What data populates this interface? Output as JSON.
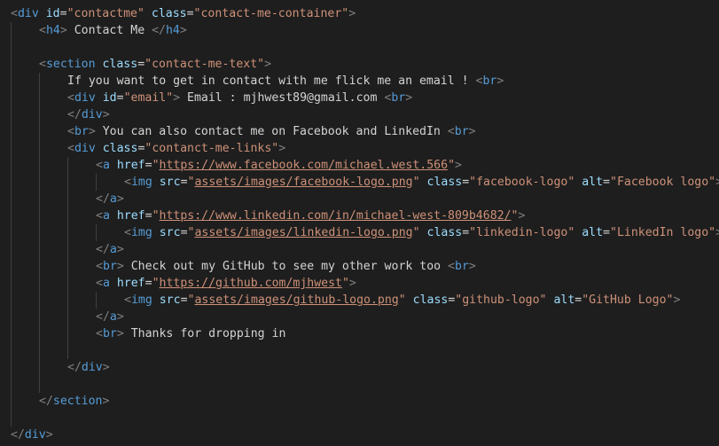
{
  "colors": {
    "background": "#1e1e1e",
    "bracket": "#808080",
    "tag": "#569cd6",
    "attribute": "#9cdcfe",
    "string": "#ce9178",
    "text": "#d4d4d4",
    "indent_guide": "#404040"
  },
  "lines": [
    {
      "indent": 0,
      "tokens": [
        [
          "br",
          "<"
        ],
        [
          "tag",
          "div"
        ],
        [
          "txt",
          " "
        ],
        [
          "attr",
          "id"
        ],
        [
          "eq",
          "="
        ],
        [
          "str",
          "\"contactme\""
        ],
        [
          "txt",
          " "
        ],
        [
          "attr",
          "class"
        ],
        [
          "eq",
          "="
        ],
        [
          "str",
          "\"contact-me-container\""
        ],
        [
          "br",
          ">"
        ]
      ]
    },
    {
      "indent": 1,
      "tokens": [
        [
          "br",
          "<"
        ],
        [
          "tag",
          "h4"
        ],
        [
          "br",
          ">"
        ],
        [
          "txt",
          " Contact Me "
        ],
        [
          "br",
          "</"
        ],
        [
          "tag",
          "h4"
        ],
        [
          "br",
          ">"
        ]
      ]
    },
    {
      "indent": 0,
      "tokens": []
    },
    {
      "indent": 1,
      "tokens": [
        [
          "br",
          "<"
        ],
        [
          "tag",
          "section"
        ],
        [
          "txt",
          " "
        ],
        [
          "attr",
          "class"
        ],
        [
          "eq",
          "="
        ],
        [
          "str",
          "\"contact-me-text\""
        ],
        [
          "br",
          ">"
        ]
      ]
    },
    {
      "indent": 2,
      "tokens": [
        [
          "txt",
          "If you want to get in contact with me flick me an email ! "
        ],
        [
          "br",
          "<"
        ],
        [
          "tag",
          "br"
        ],
        [
          "br",
          ">"
        ]
      ]
    },
    {
      "indent": 2,
      "tokens": [
        [
          "br",
          "<"
        ],
        [
          "tag",
          "div"
        ],
        [
          "txt",
          " "
        ],
        [
          "attr",
          "id"
        ],
        [
          "eq",
          "="
        ],
        [
          "str",
          "\"email\""
        ],
        [
          "br",
          ">"
        ],
        [
          "txt",
          " Email : mjhwest89@gmail.com "
        ],
        [
          "br",
          "<"
        ],
        [
          "tag",
          "br"
        ],
        [
          "br",
          ">"
        ]
      ]
    },
    {
      "indent": 2,
      "tokens": [
        [
          "br",
          "</"
        ],
        [
          "tag",
          "div"
        ],
        [
          "br",
          ">"
        ]
      ]
    },
    {
      "indent": 2,
      "tokens": [
        [
          "br",
          "<"
        ],
        [
          "tag",
          "br"
        ],
        [
          "br",
          ">"
        ],
        [
          "txt",
          " You can also contact me on Facebook and LinkedIn "
        ],
        [
          "br",
          "<"
        ],
        [
          "tag",
          "br"
        ],
        [
          "br",
          ">"
        ]
      ]
    },
    {
      "indent": 2,
      "tokens": [
        [
          "br",
          "<"
        ],
        [
          "tag",
          "div"
        ],
        [
          "txt",
          " "
        ],
        [
          "attr",
          "class"
        ],
        [
          "eq",
          "="
        ],
        [
          "str",
          "\"contanct-me-links\""
        ],
        [
          "br",
          ">"
        ]
      ]
    },
    {
      "indent": 3,
      "tokens": [
        [
          "br",
          "<"
        ],
        [
          "tag",
          "a"
        ],
        [
          "txt",
          " "
        ],
        [
          "attr",
          "href"
        ],
        [
          "eq",
          "="
        ],
        [
          "str",
          "\""
        ],
        [
          "url",
          "https://www.facebook.com/michael.west.566"
        ],
        [
          "str",
          "\""
        ],
        [
          "br",
          ">"
        ]
      ]
    },
    {
      "indent": 4,
      "tokens": [
        [
          "br",
          "<"
        ],
        [
          "tag",
          "img"
        ],
        [
          "txt",
          " "
        ],
        [
          "attr",
          "src"
        ],
        [
          "eq",
          "="
        ],
        [
          "str",
          "\""
        ],
        [
          "url",
          "assets/images/facebook-logo.png"
        ],
        [
          "str",
          "\""
        ],
        [
          "txt",
          " "
        ],
        [
          "attr",
          "class"
        ],
        [
          "eq",
          "="
        ],
        [
          "str",
          "\"facebook-logo\""
        ],
        [
          "txt",
          " "
        ],
        [
          "attr",
          "alt"
        ],
        [
          "eq",
          "="
        ],
        [
          "str",
          "\"Facebook logo\""
        ],
        [
          "br",
          ">"
        ]
      ]
    },
    {
      "indent": 3,
      "tokens": [
        [
          "br",
          "</"
        ],
        [
          "tag",
          "a"
        ],
        [
          "br",
          ">"
        ]
      ]
    },
    {
      "indent": 3,
      "tokens": [
        [
          "br",
          "<"
        ],
        [
          "tag",
          "a"
        ],
        [
          "txt",
          " "
        ],
        [
          "attr",
          "href"
        ],
        [
          "eq",
          "="
        ],
        [
          "str",
          "\""
        ],
        [
          "url",
          "https://www.linkedin.com/in/michael-west-809b4682/"
        ],
        [
          "str",
          "\""
        ],
        [
          "br",
          ">"
        ]
      ]
    },
    {
      "indent": 4,
      "tokens": [
        [
          "br",
          "<"
        ],
        [
          "tag",
          "img"
        ],
        [
          "txt",
          " "
        ],
        [
          "attr",
          "src"
        ],
        [
          "eq",
          "="
        ],
        [
          "str",
          "\""
        ],
        [
          "url",
          "assets/images/linkedin-logo.png"
        ],
        [
          "str",
          "\""
        ],
        [
          "txt",
          " "
        ],
        [
          "attr",
          "class"
        ],
        [
          "eq",
          "="
        ],
        [
          "str",
          "\"linkedin-logo\""
        ],
        [
          "txt",
          " "
        ],
        [
          "attr",
          "alt"
        ],
        [
          "eq",
          "="
        ],
        [
          "str",
          "\"LinkedIn logo\""
        ],
        [
          "br",
          ">"
        ]
      ]
    },
    {
      "indent": 3,
      "tokens": [
        [
          "br",
          "</"
        ],
        [
          "tag",
          "a"
        ],
        [
          "br",
          ">"
        ]
      ]
    },
    {
      "indent": 3,
      "tokens": [
        [
          "br",
          "<"
        ],
        [
          "tag",
          "br"
        ],
        [
          "br",
          ">"
        ],
        [
          "txt",
          " Check out my GitHub to see my other work too "
        ],
        [
          "br",
          "<"
        ],
        [
          "tag",
          "br"
        ],
        [
          "br",
          ">"
        ]
      ]
    },
    {
      "indent": 3,
      "tokens": [
        [
          "br",
          "<"
        ],
        [
          "tag",
          "a"
        ],
        [
          "txt",
          " "
        ],
        [
          "attr",
          "href"
        ],
        [
          "eq",
          "="
        ],
        [
          "str",
          "\""
        ],
        [
          "url",
          "https://github.com/mjhwest"
        ],
        [
          "str",
          "\""
        ],
        [
          "br",
          ">"
        ]
      ]
    },
    {
      "indent": 4,
      "tokens": [
        [
          "br",
          "<"
        ],
        [
          "tag",
          "img"
        ],
        [
          "txt",
          " "
        ],
        [
          "attr",
          "src"
        ],
        [
          "eq",
          "="
        ],
        [
          "str",
          "\""
        ],
        [
          "url",
          "assets/images/github-logo.png"
        ],
        [
          "str",
          "\""
        ],
        [
          "txt",
          " "
        ],
        [
          "attr",
          "class"
        ],
        [
          "eq",
          "="
        ],
        [
          "str",
          "\"github-logo\""
        ],
        [
          "txt",
          " "
        ],
        [
          "attr",
          "alt"
        ],
        [
          "eq",
          "="
        ],
        [
          "str",
          "\"GitHub Logo\""
        ],
        [
          "br",
          ">"
        ]
      ]
    },
    {
      "indent": 3,
      "tokens": [
        [
          "br",
          "</"
        ],
        [
          "tag",
          "a"
        ],
        [
          "br",
          ">"
        ]
      ]
    },
    {
      "indent": 3,
      "tokens": [
        [
          "br",
          "<"
        ],
        [
          "tag",
          "br"
        ],
        [
          "br",
          ">"
        ],
        [
          "txt",
          " Thanks for dropping in"
        ]
      ]
    },
    {
      "indent": 0,
      "tokens": []
    },
    {
      "indent": 2,
      "tokens": [
        [
          "br",
          "</"
        ],
        [
          "tag",
          "div"
        ],
        [
          "br",
          ">"
        ]
      ]
    },
    {
      "indent": 0,
      "tokens": []
    },
    {
      "indent": 1,
      "tokens": [
        [
          "br",
          "</"
        ],
        [
          "tag",
          "section"
        ],
        [
          "br",
          ">"
        ]
      ]
    },
    {
      "indent": 0,
      "tokens": []
    },
    {
      "indent": 0,
      "tokens": [
        [
          "br",
          "</"
        ],
        [
          "tag",
          "div"
        ],
        [
          "br",
          ">"
        ]
      ]
    }
  ],
  "guides": [
    {
      "level": 0,
      "from": 1,
      "to": 24
    },
    {
      "level": 1,
      "from": 4,
      "to": 22
    },
    {
      "level": 2,
      "from": 9,
      "to": 20
    },
    {
      "level": 3,
      "from": 10,
      "to": 10
    },
    {
      "level": 3,
      "from": 13,
      "to": 13
    },
    {
      "level": 3,
      "from": 17,
      "to": 17
    }
  ]
}
